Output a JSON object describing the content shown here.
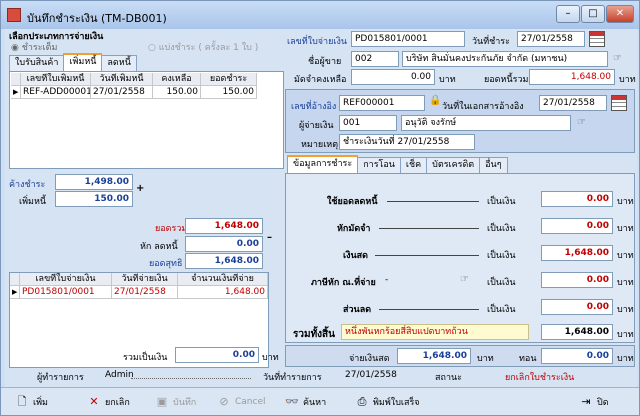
{
  "window": {
    "title": "บันทึกชำระเงิน (TM-DB001)",
    "min": "–",
    "max": "□",
    "close": "✕"
  },
  "payment_type": {
    "heading": "เลือกประเภทการจ่ายเงิน",
    "full_label": "ชำระเต็ม",
    "install_label": "แบ่งชำระ ( ครั้งละ 1 ใบ )"
  },
  "left_tabs": [
    "ใบรับสินค้า",
    "เพิ่มหนี้",
    "ลดหนี้"
  ],
  "debit_grid": {
    "headers": [
      "เลขที่ใบเพิ่มหนี้",
      "วันที่เพิ่มหนี้",
      "คงเหลือ",
      "ยอดชำระ"
    ],
    "rows": [
      [
        "REF-ADD00001",
        "27/01/2558",
        "150.00",
        "150.00"
      ]
    ]
  },
  "left_totals": {
    "due_label": "ค้างชำระ",
    "due": "1,498.00",
    "add_label": "เพิ่มหนี้",
    "add": "150.00",
    "total_label": "ยอดรวม",
    "total": "1,648.00",
    "less_label": "หัก ลดหนี้",
    "less": "0.00",
    "net_label": "ยอดสุทธิ",
    "net": "1,648.00",
    "plus": "+",
    "minus": "–"
  },
  "voucher_grid": {
    "headers": [
      "เลขที่ใบจ่ายเงิน",
      "วันที่จ่ายเงิน",
      "จำนวนเงินที่จ่าย"
    ],
    "rows": [
      [
        "PD015801/0001",
        "27/01/2558",
        "1,648.00"
      ]
    ]
  },
  "left_sum": {
    "label": "รวมเป็นเงิน",
    "value": "0.00",
    "unit": "บาท"
  },
  "header": {
    "voucher_no_label": "เลขที่ใบจ่ายเงิน",
    "voucher_no": "PD015801/0001",
    "pay_date_label": "วันที่ชำระ",
    "pay_date": "27/01/2558",
    "vendor_label": "ชื่อผู้ขาย",
    "vendor_code": "002",
    "vendor_name": "บริษัท สินมั่นคงประกันภัย จำกัด (มหาชน)",
    "deposit_label": "มัดจำคงเหลือ",
    "deposit": "0.00",
    "deposit_unit": "บาท",
    "total_label": "ยอดหนี้รวม",
    "total": "1,648.00",
    "total_unit": "บาท"
  },
  "ref": {
    "ref_label": "เลขที่อ้างอิง",
    "ref_no": "REF000001",
    "ref_date_label": "วันที่ในเอกสารอ้างอิง",
    "ref_date": "27/01/2558",
    "payer_label": "ผู้จ่ายเงิน",
    "payer_code": "001",
    "payer_name": "อนุวัติ จงรักษ์",
    "note_label": "หมายเหตุ",
    "note": "ชำระเงินวันที่ 27/01/2558"
  },
  "right_tabs": [
    "ข้อมูลการชำระ",
    "การโอน",
    "เช็ค",
    "บัตรเครดิต",
    "อื่นๆ"
  ],
  "pay_rows": [
    {
      "label": "ใช้ยอดลดหนี้",
      "as": "เป็นเงิน",
      "value": "0.00",
      "unit": "บาท"
    },
    {
      "label": "หักมัดจำ",
      "as": "เป็นเงิน",
      "value": "0.00",
      "unit": "บาท"
    },
    {
      "label": "เงินสด",
      "as": "เป็นเงิน",
      "value": "1,648.00",
      "unit": "บาท"
    },
    {
      "label": "ภาษีหัก ณ.ที่จ่าย",
      "as": "เป็นเงิน",
      "value": "0.00",
      "unit": "บาท"
    },
    {
      "label": "ส่วนลด",
      "as": "เป็นเงิน",
      "value": "0.00",
      "unit": "บาท"
    }
  ],
  "grand": {
    "label": "รวมทั้งสิ้น",
    "words": "หนึ่งพันหกร้อยสี่สิบแปดบาทถ้วน",
    "value": "1,648.00",
    "unit": "บาท"
  },
  "cash": {
    "paid_label": "จ่ายเงินสด",
    "paid": "1,648.00",
    "paid_unit": "บาท",
    "change_label": "ทอน",
    "change": "0.00",
    "change_unit": "บาท"
  },
  "status": {
    "user_label": "ผู้ทำรายการ",
    "user": "Admin",
    "date_label": "วันที่ทำรายการ",
    "date": "27/01/2558",
    "state_label": "สถานะ",
    "state": "ยกเลิกใบชำระเงิน"
  },
  "toolbar": {
    "add": "เพิ่ม",
    "void": "ยกเลิก",
    "save": "บันทึก",
    "cancel": "Cancel",
    "search": "ค้นหา",
    "print": "พิมพ์ใบเสร็จ",
    "close": "ปิด"
  },
  "colors": {
    "accent_blue": "#1a3f9a",
    "amount_red": "#c00000",
    "form_bg": "#d6e3f3"
  }
}
